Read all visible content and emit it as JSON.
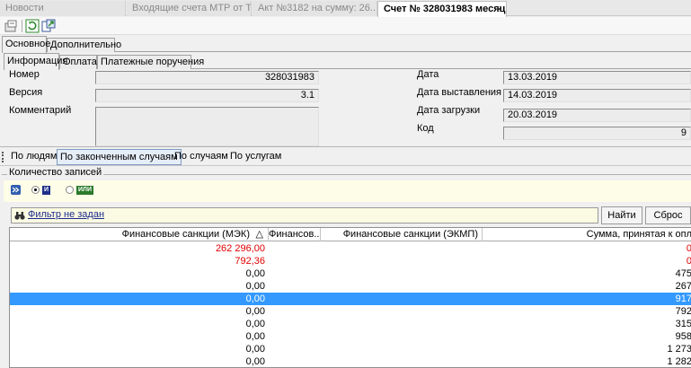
{
  "doc_tabs": [
    {
      "label": "Новости"
    },
    {
      "label": "Входящие счета МТР от Т..."
    },
    {
      "label": "Акт №3182 на сумму: 26..."
    },
    {
      "label": "Счет № 328031983 месяц...",
      "close": "×"
    }
  ],
  "tabs_main": [
    "Основное",
    "Дополнительно"
  ],
  "tabs_sub": [
    "Информация",
    "Оплата",
    "Платежные поручения"
  ],
  "form": {
    "nomer_label": "Номер",
    "nomer_value": "328031983",
    "versiya_label": "Версия",
    "versiya_value": "3.1",
    "comment_label": "Комментарий",
    "comment_value": "",
    "data_label": "Дата",
    "data_value": "13.03.2019",
    "data_vyst_label": "Дата выставления",
    "data_vyst_value": "14.03.2019",
    "data_zagr_label": "Дата загрузки",
    "data_zagr_value": "20.03.2019",
    "kod_label": "Код",
    "kod_value": "9"
  },
  "view_tabs": [
    "По людям",
    "По законченным случаям",
    "По случаям",
    "По услугам"
  ],
  "group_title": "Количество записей",
  "filter": {
    "and_label": "И",
    "or_label": "ИЛИ",
    "text": "Фильтр не задан",
    "find_button": "Найти",
    "reset_button": "Сброс"
  },
  "grid": {
    "columns": [
      "Финансовые санкции (МЭК)",
      "Финансов...",
      "Финансовые санкции (ЭКМП)",
      "Сумма, принятая к опл"
    ],
    "sort_indicator": "△",
    "rows": [
      {
        "mek": "262 296,00",
        "summa": "0",
        "red": true
      },
      {
        "mek": "792,36",
        "summa": "0",
        "red": true
      },
      {
        "mek": "0,00",
        "summa": "475",
        "red": false
      },
      {
        "mek": "0,00",
        "summa": "267",
        "red": false
      },
      {
        "mek": "0,00",
        "summa": "917",
        "red": false,
        "selected": true
      },
      {
        "mek": "0,00",
        "summa": "792",
        "red": false
      },
      {
        "mek": "0,00",
        "summa": "315",
        "red": false
      },
      {
        "mek": "0,00",
        "summa": "958",
        "red": false
      },
      {
        "mek": "0,00",
        "summa": "1 273",
        "red": false
      },
      {
        "mek": "0,00",
        "summa": "1 282",
        "red": false
      }
    ]
  },
  "colors": {
    "selection": "#3399ff",
    "negative": "#e00000",
    "filter_bg": "#fdfde8",
    "link": "#1d2a8c"
  },
  "icons": [
    "properties-icon",
    "refresh-icon",
    "export-icon",
    "expand-filter-icon",
    "binoculars-icon"
  ]
}
